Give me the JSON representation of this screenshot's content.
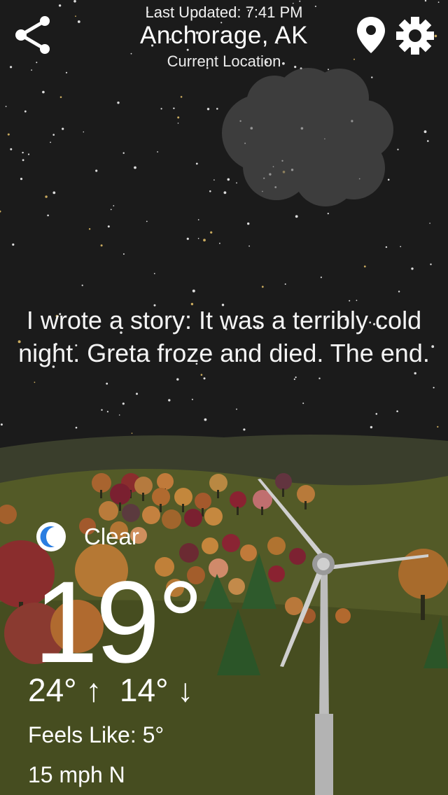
{
  "header": {
    "last_updated": "Last Updated: 7:41 PM",
    "city": "Anchorage, AK",
    "location_label": "Current Location"
  },
  "quote": "I wrote a story: It was a terribly cold night. Greta froze and died. The end.",
  "weather": {
    "condition": "Clear",
    "condition_icon": "moon-icon",
    "temperature": "19°",
    "high_low": "24° ↑  14° ↓",
    "feels_like": "Feels Like: 5°",
    "wind": "15 mph N"
  },
  "icons": {
    "share": "share-icon",
    "location": "location-pin-icon",
    "settings": "gear-icon"
  },
  "colors": {
    "sky": "#1b1b1b",
    "hills": "#535a27",
    "moon_accent": "#2a7de1",
    "turbine": "#c9c9c9"
  }
}
